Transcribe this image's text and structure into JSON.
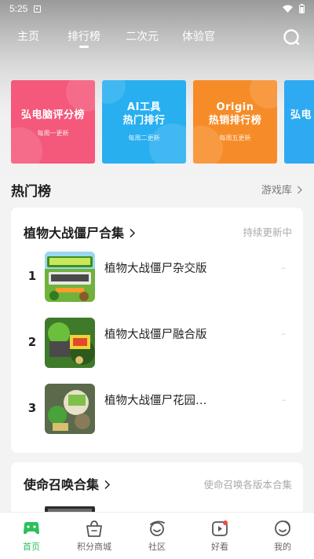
{
  "status_bar": {
    "time": "5:25"
  },
  "top_nav": {
    "tabs": [
      "主页",
      "排行榜",
      "二次元",
      "体验官"
    ],
    "active_tab": "排行榜"
  },
  "banners": [
    {
      "title_lines": [
        "弘电脑评分榜"
      ],
      "subtitle": "每周一更新",
      "color": "#f4587a"
    },
    {
      "title_lines": [
        "AI工具",
        "热门排行"
      ],
      "subtitle": "每周二更新",
      "color": "#27aff0"
    },
    {
      "title_lines": [
        "Origin",
        "热销排行榜"
      ],
      "subtitle": "每周五更新",
      "color": "#f68c28"
    },
    {
      "title_lines": [
        "弘电"
      ],
      "subtitle": "",
      "color": "#2eaaf2"
    }
  ],
  "hot_section": {
    "title": "热门榜",
    "link": "游戏库"
  },
  "cards": [
    {
      "title": "植物大战僵尸合集",
      "side_text": "持续更新中",
      "items": [
        {
          "rank": "1",
          "name": "植物大战僵尸杂交版",
          "extra": "–"
        },
        {
          "rank": "2",
          "name": "植物大战僵尸融合版",
          "extra": "–"
        },
        {
          "rank": "3",
          "name": "植物大战僵尸花园…",
          "extra": "–"
        }
      ]
    },
    {
      "title": "使命召唤合集",
      "side_text": "使命召唤各版本合集",
      "items": []
    }
  ],
  "bottom_nav": [
    {
      "label": "首页",
      "icon": "gamepad-icon",
      "active": true
    },
    {
      "label": "积分商城",
      "icon": "shopping-bag-icon",
      "active": false
    },
    {
      "label": "社区",
      "icon": "community-icon",
      "active": false
    },
    {
      "label": "好看",
      "icon": "video-icon",
      "active": false
    },
    {
      "label": "我的",
      "icon": "profile-icon",
      "active": false
    }
  ],
  "colors": {
    "accent": "#2cbf5a"
  }
}
